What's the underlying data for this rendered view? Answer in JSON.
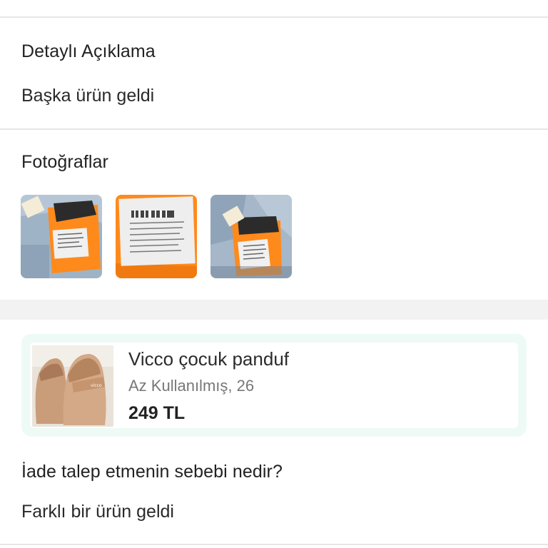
{
  "description_section": {
    "title": "Detaylı Açıklama",
    "value": "Başka ürün geldi"
  },
  "photos_section": {
    "title": "Fotoğraflar",
    "photos": [
      {
        "icon": "package-photo-icon"
      },
      {
        "icon": "shipping-label-photo-icon"
      },
      {
        "icon": "package-photo-icon"
      }
    ]
  },
  "product": {
    "name": "Vicco çocuk panduf",
    "condition": "Az Kullanılmış, 26",
    "price": "249 TL"
  },
  "return_reason": {
    "question": "İade talep etmenin sebebi nedir?",
    "answer": "Farklı bir ürün geldi"
  },
  "colors": {
    "card_tint": "#eefaf5",
    "divider": "#e6e6e6",
    "band": "#f2f2f2",
    "package_orange": "#ff8a1c"
  }
}
